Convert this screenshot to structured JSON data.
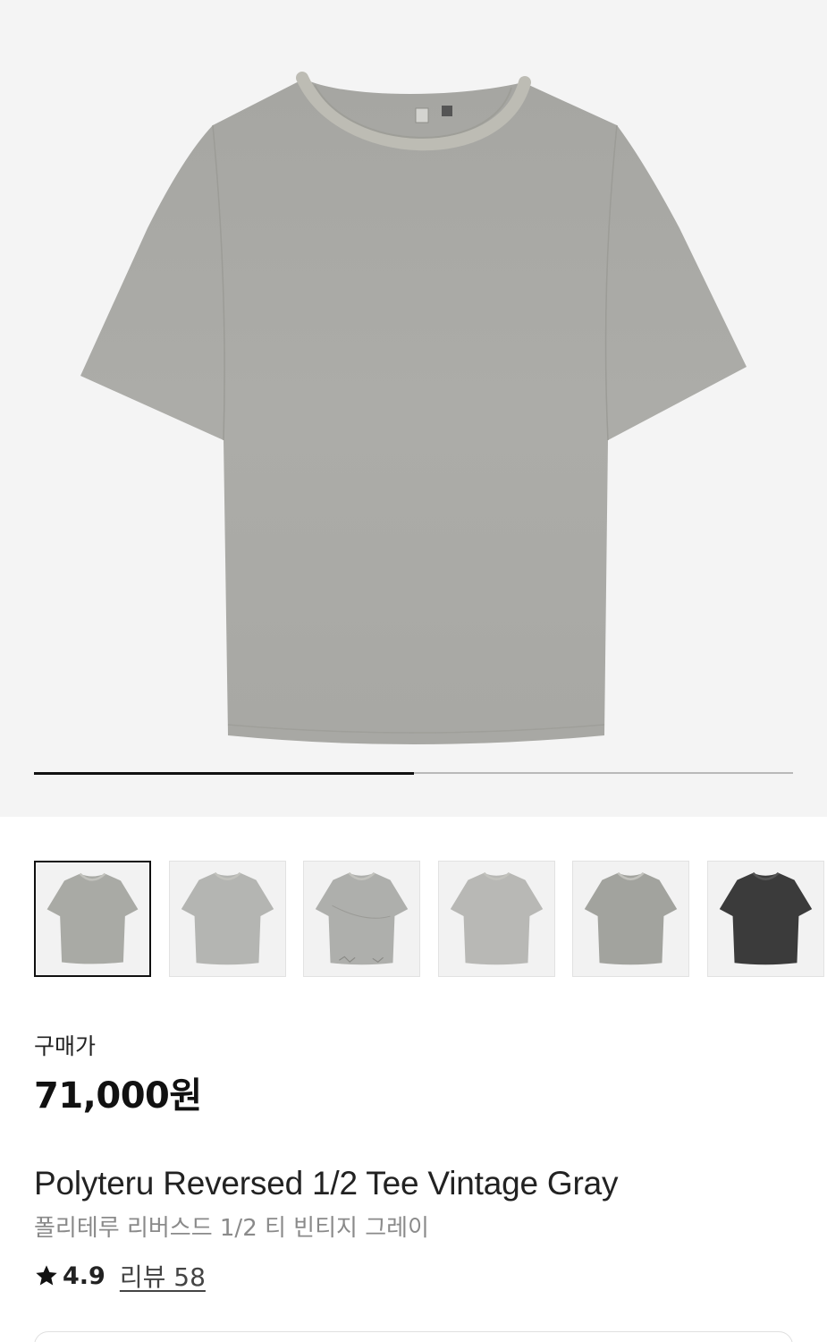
{
  "gallery": {
    "progress_fraction": 0.5,
    "thumbnails": [
      {
        "color": "#a9aaa5",
        "variant": "tee",
        "selected": true
      },
      {
        "color": "#b4b5b2",
        "variant": "tee"
      },
      {
        "color": "#aeafac",
        "variant": "tee-distressed"
      },
      {
        "color": "#b8b8b5",
        "variant": "tee"
      },
      {
        "color": "#a2a39e",
        "variant": "tee"
      },
      {
        "color": "#3b3b3b",
        "variant": "tee"
      }
    ]
  },
  "colors": {
    "hero_background": "#f4f4f4",
    "shirt_gray": "#ababa7"
  },
  "product": {
    "price_label": "구매가",
    "price": "71,000원",
    "name_en": "Polyteru Reversed 1/2 Tee Vintage Gray",
    "name_ko": "폴리테루 리버스드 1/2 티 빈티지 그레이",
    "rating_icon": "star-icon",
    "rating": "4.9",
    "review_link": "리뷰 58"
  }
}
